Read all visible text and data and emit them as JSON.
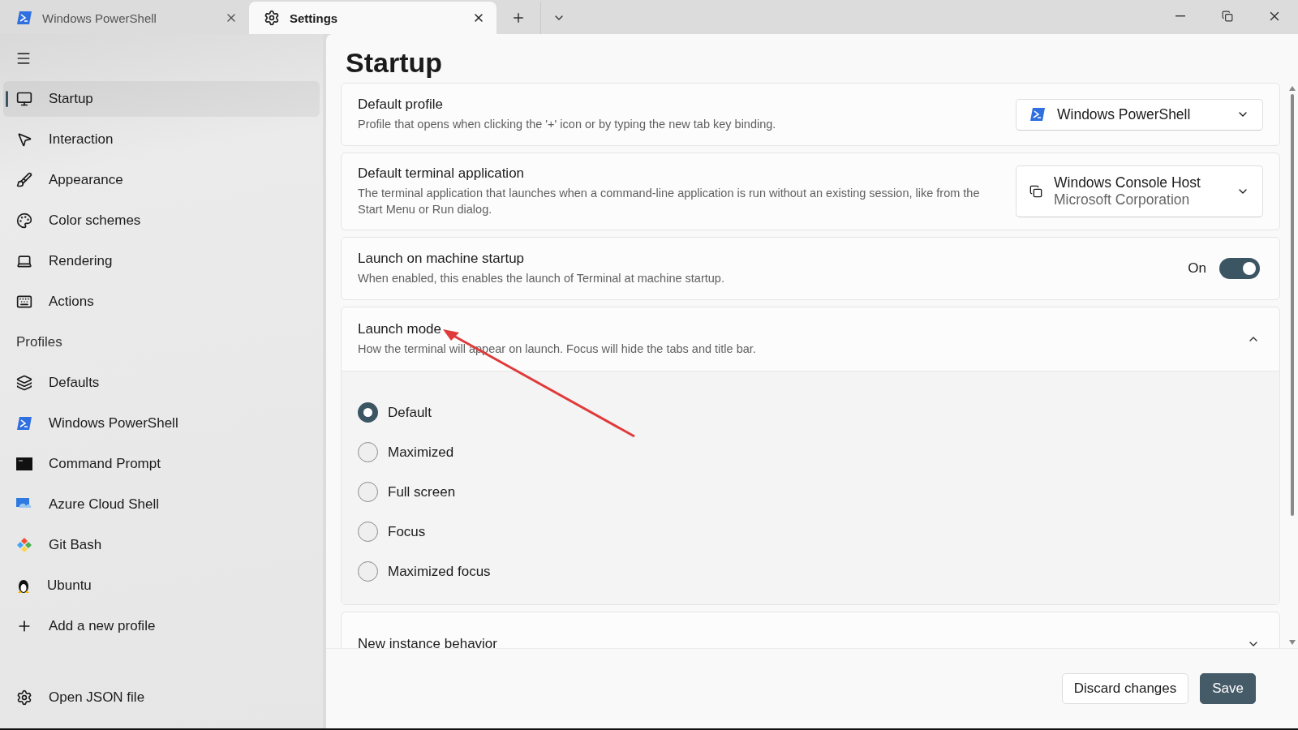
{
  "tabs": [
    {
      "label": "Windows PowerShell",
      "selected": false
    },
    {
      "label": "Settings",
      "selected": true
    }
  ],
  "sidebar": {
    "items": [
      {
        "label": "Startup",
        "selected": true
      },
      {
        "label": "Interaction",
        "selected": false
      },
      {
        "label": "Appearance",
        "selected": false
      },
      {
        "label": "Color schemes",
        "selected": false
      },
      {
        "label": "Rendering",
        "selected": false
      },
      {
        "label": "Actions",
        "selected": false
      }
    ],
    "profiles_heading": "Profiles",
    "profiles": [
      {
        "label": "Defaults",
        "selected": false
      },
      {
        "label": "Windows PowerShell",
        "selected": false
      },
      {
        "label": "Command Prompt",
        "selected": false
      },
      {
        "label": "Azure Cloud Shell",
        "selected": false
      },
      {
        "label": "Git Bash",
        "selected": false
      },
      {
        "label": "Ubuntu",
        "selected": false
      }
    ],
    "add_profile": "Add a new profile",
    "footer_item": "Open JSON file"
  },
  "page": {
    "title": "Startup",
    "settings": [
      {
        "kind": "dropdown",
        "title": "Default profile",
        "description": "Profile that opens when clicking the '+' icon or by typing the new tab key binding.",
        "value": "Windows PowerShell"
      },
      {
        "kind": "dropdown",
        "title": "Default terminal application",
        "description": "The terminal application that launches when a command-line application is run without an existing session, like from the Start Menu or Run dialog.",
        "value": "Windows Console Host",
        "subvalue": "Microsoft Corporation"
      },
      {
        "kind": "toggle",
        "title": "Launch on machine startup",
        "description": "When enabled, this enables the launch of Terminal at machine startup.",
        "on": true,
        "state_label": "On"
      },
      {
        "kind": "expander",
        "title": "Launch mode",
        "description": "How the terminal will appear on launch. Focus will hide the tabs and title bar.",
        "expanded": true,
        "options": [
          {
            "label": "Default",
            "selected": true
          },
          {
            "label": "Maximized",
            "selected": false
          },
          {
            "label": "Full screen",
            "selected": false
          },
          {
            "label": "Focus",
            "selected": false
          },
          {
            "label": "Maximized focus",
            "selected": false
          }
        ]
      },
      {
        "kind": "expander",
        "title": "New instance behavior",
        "expanded": false
      }
    ]
  },
  "buttons": [
    {
      "label": "Discard changes",
      "kind": "secondary"
    },
    {
      "label": "Save",
      "kind": "primary"
    }
  ]
}
